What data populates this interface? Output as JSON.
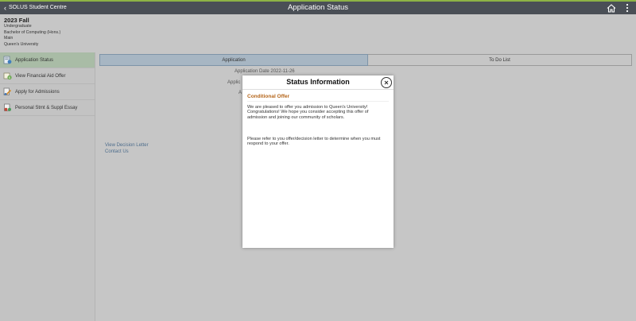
{
  "header": {
    "back_label": "SOLUS Student Centre",
    "title": "Application Status",
    "home_icon": "home-icon",
    "menu_icon": "kebab-menu-icon"
  },
  "context": {
    "term": "2023 Fall",
    "career": "Undergraduate",
    "program": "Bachelor of Computing (Hons.)",
    "campus": "Main",
    "institution": "Queen's University"
  },
  "sidebar": {
    "items": [
      {
        "label": "Application Status",
        "icon": "application-status-icon"
      },
      {
        "label": "View Financial Aid Offer",
        "icon": "financial-aid-icon"
      },
      {
        "label": "Apply for Admissions",
        "icon": "apply-admissions-icon"
      },
      {
        "label": "Personal Stmt & Suppl Essay",
        "icon": "personal-statement-icon"
      }
    ]
  },
  "tabs": [
    {
      "label": "Application"
    },
    {
      "label": "To Do List"
    }
  ],
  "main": {
    "application_date_label": "Application Date",
    "application_date_value": "2022-11-26",
    "partial_label_1": "Applic",
    "partial_label_2": "A",
    "links": {
      "view_decision_letter": "View Decision Letter",
      "contact_us": "Contact Us"
    }
  },
  "modal": {
    "title": "Status Information",
    "close_icon": "close-icon",
    "status_heading": "Conditional Offer",
    "paragraph_1": "We are pleased to offer you admission to Queen's University! Congratulations! We hope you consider accepting this offer of admission and joining our community of scholars.",
    "paragraph_2": "Please refer to you offer/decision letter to determine when you must respond to your offer."
  },
  "colors": {
    "header_bg": "#4a4f56",
    "accent_bar": "#8db346",
    "active_sidebar_bg": "#a9bca6",
    "active_tab_bg": "#a7b6c3",
    "status_heading": "#b5661b",
    "link": "#4e6d8c",
    "overlay": "#c6c6c6"
  }
}
